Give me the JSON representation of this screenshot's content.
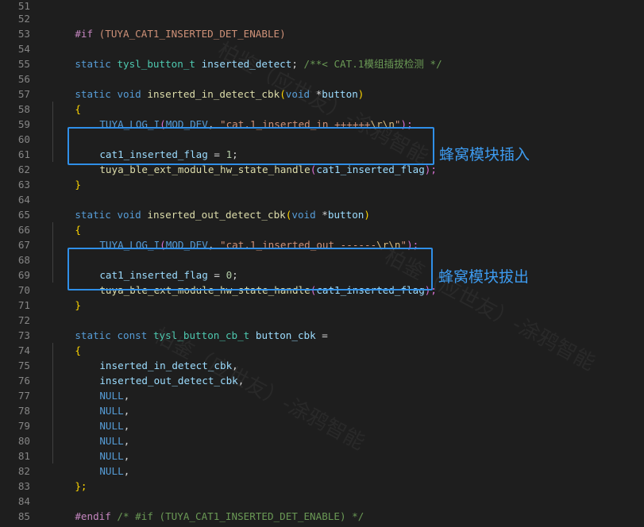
{
  "editor": {
    "line_numbers": [
      "51",
      "52",
      "53",
      "54",
      "55",
      "56",
      "57",
      "58",
      "59",
      "60",
      "61",
      "62",
      "63",
      "64",
      "65",
      "66",
      "67",
      "68",
      "69",
      "70",
      "71",
      "72",
      "73",
      "74",
      "75",
      "76",
      "77",
      "78",
      "79",
      "80",
      "81",
      "82",
      "83",
      "84",
      "85"
    ],
    "code": {
      "l52": {
        "directive": "#if",
        "cond": " (TUYA_CAT1_INSERTED_DET_ENABLE)"
      },
      "l54": {
        "kw": "static",
        "type": "tysl_button_t",
        "name": "inserted_detect",
        "semi": ";",
        "comment": "/**< CAT.1模组插拔检测 */"
      },
      "l56": {
        "kw1": "static",
        "kw2": "void",
        "fn": "inserted_in_detect_cbk",
        "open": "(",
        "kw3": "void",
        "star": " *",
        "param": "button",
        "close": ")"
      },
      "l57": {
        "brace": "{"
      },
      "l58": {
        "macro": "TUYA_LOG_I",
        "open": "(",
        "arg1": "MOD_DEV",
        "comma": ", ",
        "str_a": "\"cat.1_inserted_in ++++++",
        "esc": "\\r\\n",
        "str_b": "\"",
        "close": ");"
      },
      "l60": {
        "var": "cat1_inserted_flag",
        "op": " = ",
        "num": "1",
        "semi": ";"
      },
      "l61": {
        "fn": "tuya_ble_ext_module_hw_state_handle",
        "open": "(",
        "arg": "cat1_inserted_flag",
        "close": ");"
      },
      "l62": {
        "brace": "}"
      },
      "l64": {
        "kw1": "static",
        "kw2": "void",
        "fn": "inserted_out_detect_cbk",
        "open": "(",
        "kw3": "void",
        "star": " *",
        "param": "button",
        "close": ")"
      },
      "l65": {
        "brace": "{"
      },
      "l66": {
        "macro": "TUYA_LOG_I",
        "open": "(",
        "arg1": "MOD_DEV",
        "comma": ", ",
        "str_a": "\"cat.1_inserted_out ------",
        "esc": "\\r\\n",
        "str_b": "\"",
        "close": ");"
      },
      "l68": {
        "var": "cat1_inserted_flag",
        "op": " = ",
        "num": "0",
        "semi": ";"
      },
      "l69": {
        "fn": "tuya_ble_ext_module_hw_state_handle",
        "open": "(",
        "arg": "cat1_inserted_flag",
        "close": ");"
      },
      "l70": {
        "brace": "}"
      },
      "l72": {
        "kw1": "static",
        "kw2": "const",
        "type": "tysl_button_cb_t",
        "name": "button_cbk",
        "op": " ="
      },
      "l73": {
        "brace": "{"
      },
      "l74": {
        "name": "inserted_in_detect_cbk",
        "comma": ","
      },
      "l75": {
        "name": "inserted_out_detect_cbk",
        "comma": ","
      },
      "l76": {
        "null": "NULL",
        "comma": ","
      },
      "l77": {
        "null": "NULL",
        "comma": ","
      },
      "l78": {
        "null": "NULL",
        "comma": ","
      },
      "l79": {
        "null": "NULL",
        "comma": ","
      },
      "l80": {
        "null": "NULL",
        "comma": ","
      },
      "l81": {
        "null": "NULL",
        "comma": ","
      },
      "l82": {
        "brace": "};"
      },
      "l84": {
        "directive": "#endif",
        "comment": " /* #if (TUYA_CAT1_INSERTED_DET_ENABLE) */"
      }
    }
  },
  "annotations": {
    "insert_label": "蜂窝模块插入",
    "remove_label": "蜂窝模块拔出"
  },
  "watermark": {
    "text": "柏鉴（应世友）-涂鸦智能"
  },
  "colors": {
    "background": "#1e1e1e",
    "highlight_box": "#2f8fe8",
    "annotation_text": "#3d9bef"
  }
}
